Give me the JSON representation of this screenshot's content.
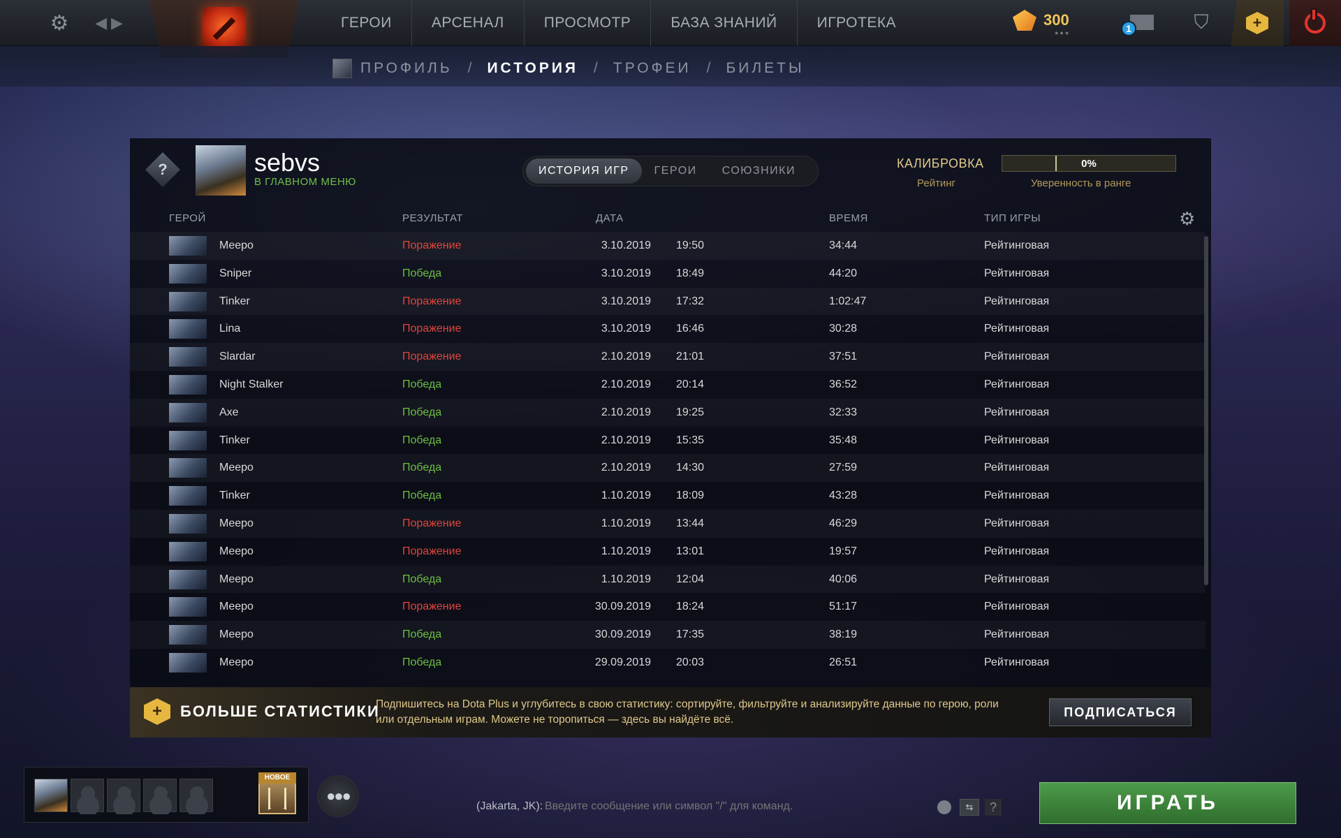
{
  "topbar": {
    "nav": [
      "ГЕРОИ",
      "АРСЕНАЛ",
      "ПРОСМОТР",
      "БАЗА ЗНАНИЙ",
      "ИГРОТЕКА"
    ],
    "currency_value": "300",
    "mail_badge": "1",
    "plus_glyph": "+"
  },
  "subnav": {
    "items": [
      "ПРОФИЛЬ",
      "ИСТОРИЯ",
      "ТРОФЕИ",
      "БИЛЕТЫ"
    ],
    "separator": "/",
    "active_index": 1
  },
  "profile": {
    "name": "sebvs",
    "status": "В ГЛАВНОМ МЕНЮ",
    "rank_glyph": "?"
  },
  "tabs": [
    "ИСТОРИЯ ИГР",
    "ГЕРОИ",
    "СОЮЗНИКИ"
  ],
  "calibration": {
    "label": "КАЛИБРОВКА",
    "rating_label": "Рейтинг",
    "confidence_value": "0%",
    "confidence_fraction": 0.0,
    "confidence_label": "Уверенность в ранге"
  },
  "table": {
    "headers": {
      "hero": "ГЕРОЙ",
      "result": "РЕЗУЛЬТАТ",
      "date": "ДАТА",
      "duration": "ВРЕМЯ",
      "game_type": "ТИП ИГРЫ"
    },
    "rows": [
      {
        "hero": "Meepo",
        "result": "Поражение",
        "win": false,
        "date": "3.10.2019",
        "time": "19:50",
        "duration": "34:44",
        "type": "Рейтинговая"
      },
      {
        "hero": "Sniper",
        "result": "Победа",
        "win": true,
        "date": "3.10.2019",
        "time": "18:49",
        "duration": "44:20",
        "type": "Рейтинговая"
      },
      {
        "hero": "Tinker",
        "result": "Поражение",
        "win": false,
        "date": "3.10.2019",
        "time": "17:32",
        "duration": "1:02:47",
        "type": "Рейтинговая"
      },
      {
        "hero": "Lina",
        "result": "Поражение",
        "win": false,
        "date": "3.10.2019",
        "time": "16:46",
        "duration": "30:28",
        "type": "Рейтинговая"
      },
      {
        "hero": "Slardar",
        "result": "Поражение",
        "win": false,
        "date": "2.10.2019",
        "time": "21:01",
        "duration": "37:51",
        "type": "Рейтинговая"
      },
      {
        "hero": "Night Stalker",
        "result": "Победа",
        "win": true,
        "date": "2.10.2019",
        "time": "20:14",
        "duration": "36:52",
        "type": "Рейтинговая"
      },
      {
        "hero": "Axe",
        "result": "Победа",
        "win": true,
        "date": "2.10.2019",
        "time": "19:25",
        "duration": "32:33",
        "type": "Рейтинговая"
      },
      {
        "hero": "Tinker",
        "result": "Победа",
        "win": true,
        "date": "2.10.2019",
        "time": "15:35",
        "duration": "35:48",
        "type": "Рейтинговая"
      },
      {
        "hero": "Meepo",
        "result": "Победа",
        "win": true,
        "date": "2.10.2019",
        "time": "14:30",
        "duration": "27:59",
        "type": "Рейтинговая"
      },
      {
        "hero": "Tinker",
        "result": "Победа",
        "win": true,
        "date": "1.10.2019",
        "time": "18:09",
        "duration": "43:28",
        "type": "Рейтинговая"
      },
      {
        "hero": "Meepo",
        "result": "Поражение",
        "win": false,
        "date": "1.10.2019",
        "time": "13:44",
        "duration": "46:29",
        "type": "Рейтинговая"
      },
      {
        "hero": "Meepo",
        "result": "Поражение",
        "win": false,
        "date": "1.10.2019",
        "time": "13:01",
        "duration": "19:57",
        "type": "Рейтинговая"
      },
      {
        "hero": "Meepo",
        "result": "Победа",
        "win": true,
        "date": "1.10.2019",
        "time": "12:04",
        "duration": "40:06",
        "type": "Рейтинговая"
      },
      {
        "hero": "Meepo",
        "result": "Поражение",
        "win": false,
        "date": "30.09.2019",
        "time": "18:24",
        "duration": "51:17",
        "type": "Рейтинговая"
      },
      {
        "hero": "Meepo",
        "result": "Победа",
        "win": true,
        "date": "30.09.2019",
        "time": "17:35",
        "duration": "38:19",
        "type": "Рейтинговая"
      },
      {
        "hero": "Meepo",
        "result": "Победа",
        "win": true,
        "date": "29.09.2019",
        "time": "20:03",
        "duration": "26:51",
        "type": "Рейтинговая"
      }
    ]
  },
  "plus_banner": {
    "title": "БОЛЬШЕ СТАТИСТИКИ",
    "text": "Подпишитесь на Dota Plus и углубитесь в свою статистику: сортируйте, фильтруйте и анализируйте данные по герою, роли или отдельным играм. Можете не торопиться — здесь вы найдёте всё.",
    "button": "ПОДПИСАТЬСЯ"
  },
  "bottom": {
    "battlepass_badge": "НОВОЕ",
    "chat_channel": "(Jakarta, JK):",
    "chat_placeholder": "Введите сообщение или символ \"/\" для команд.",
    "chat_help": "?",
    "play_button": "ИГРАТЬ"
  },
  "colors": {
    "win": "#6cbf40",
    "loss": "#e0453c",
    "gold": "#e0c98a",
    "play_green": "#3f8a3c"
  }
}
